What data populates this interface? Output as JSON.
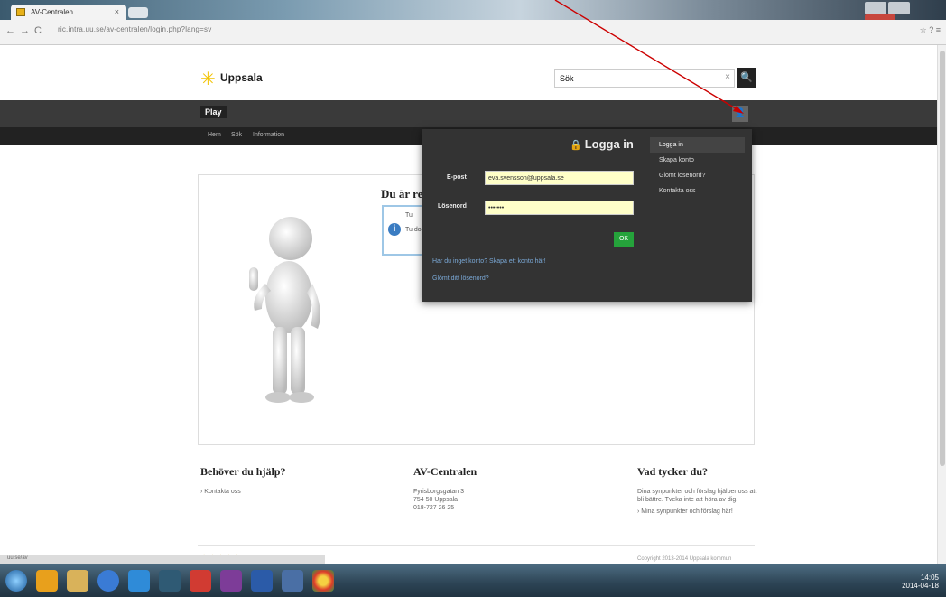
{
  "browser": {
    "tab_title": "AV-Centralen",
    "tab_close": "×",
    "url": "ric.intra.uu.se/av-centralen/login.php?lang=sv",
    "nav": {
      "back": "←",
      "forward": "→",
      "reload": "C"
    },
    "right_icons": "☆ ? ≡"
  },
  "site": {
    "logo_mark": "✳",
    "logo_text": "Uppsala",
    "search": {
      "value": "Sök",
      "clear": "×",
      "button": "🔍"
    },
    "brand_tab": "Play",
    "user_icon": "👤",
    "subnav": [
      "Hem",
      "Sök",
      "Information"
    ]
  },
  "main": {
    "title": "Du är re",
    "info_line1": "Tu",
    "info_line2": "Tu do",
    "info_icon": "i"
  },
  "login": {
    "title": "Logga in",
    "lock_icon": "🔒",
    "email_label": "E-post",
    "email_value": "eva.svensson@uppsala.se",
    "password_label": "Lösenord",
    "password_value": "•••••••",
    "ok_button": "OK",
    "link_create": "Har du inget konto? Skapa ett konto här!",
    "link_forgot": "Glömt ditt lösenord?",
    "menu": [
      "Logga in",
      "Skapa konto",
      "Glömt lösenord?",
      "Kontakta oss"
    ]
  },
  "footer": {
    "help_title": "Behöver du hjälp?",
    "help_link": "› Kontakta oss",
    "org_title": "AV-Centralen",
    "org_lines": [
      "Fyrisborgsgatan 3",
      "754 50 Uppsala",
      "018-727 26 25"
    ],
    "feedback_title": "Vad tycker du?",
    "feedback_text": "Dina synpunkter och förslag hjälper oss att bli bättre. Tveka inte att höra av dig.",
    "feedback_link": "› Mina synpunkter och förslag här!",
    "copyright": "Copyright 2013-2014 Uppsala kommun",
    "logo": "★★★★★"
  },
  "statusbar": "uu.se/av",
  "tray": {
    "time": "14:05",
    "date": "2014-04-18"
  },
  "colors": {
    "header_dark": "#3a3a3a",
    "login_bg": "#333333",
    "ok_green": "#25a33b",
    "annotation_red": "#cc0000"
  }
}
